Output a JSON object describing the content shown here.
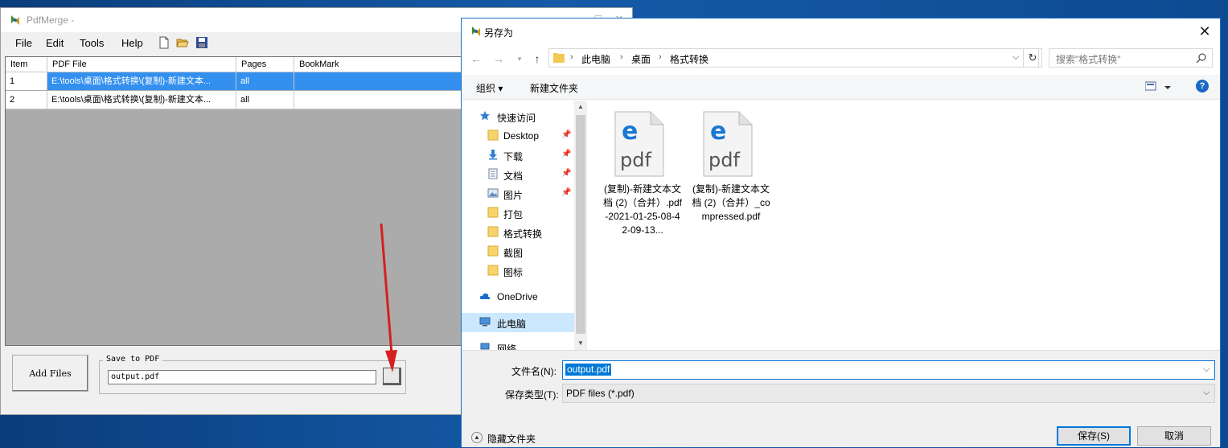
{
  "pdfmerge": {
    "title": "PdfMerge -",
    "menu": {
      "file": "File",
      "edit": "Edit",
      "tools": "Tools",
      "help": "Help"
    },
    "toolbar_icons": [
      "new-document-icon",
      "open-folder-icon",
      "save-disk-icon"
    ],
    "grid": {
      "headers": {
        "item": "Item",
        "pdf_file": "PDF File",
        "pages": "Pages",
        "bookmark": "BookMark"
      },
      "rows": [
        {
          "item": "1",
          "pdf_file": "E:\\tools\\桌面\\格式转换\\(复制)-新建文本...",
          "pages": "all",
          "bookmark": ""
        },
        {
          "item": "2",
          "pdf_file": "E:\\tools\\桌面\\格式转换\\(复制)-新建文本...",
          "pages": "all",
          "bookmark": ""
        }
      ]
    },
    "add_files_label": "Add Files",
    "save_group_label": "Save to PDF",
    "output_value": "output.pdf"
  },
  "dialog": {
    "title": "另存为",
    "breadcrumbs": [
      "此电脑",
      "桌面",
      "格式转换"
    ],
    "search_placeholder": "搜索\"格式转换\"",
    "toolbar": {
      "organize": "组织 ▾",
      "new_folder": "新建文件夹"
    },
    "nav": {
      "quick_access": "快速访问",
      "desktop": "Desktop",
      "downloads": "下载",
      "documents": "文档",
      "pictures": "图片",
      "pack": "打包",
      "format_convert": "格式转换",
      "screenshots": "截图",
      "icons": "图标",
      "onedrive": "OneDrive",
      "this_pc": "此电脑",
      "network": "网络"
    },
    "files": [
      {
        "name": "(复制)-新建文本文档 (2)（合并）.pdf-2021-01-25-08-42-09-13...",
        "icon": "edge-pdf-icon"
      },
      {
        "name": "(复制)-新建文本文档 (2)（合并）_compressed.pdf",
        "icon": "edge-pdf-icon"
      }
    ],
    "filename_label": "文件名(N):",
    "filename_value": "output.pdf",
    "filetype_label": "保存类型(T):",
    "filetype_value": "PDF files (*.pdf)",
    "hide_folders": "隐藏文件夹",
    "save_button": "保存(S)",
    "cancel_button": "取消"
  },
  "colors": {
    "selection_blue": "#3390ef",
    "dialog_accent": "#0078d7",
    "arrow_red": "#d42020"
  }
}
